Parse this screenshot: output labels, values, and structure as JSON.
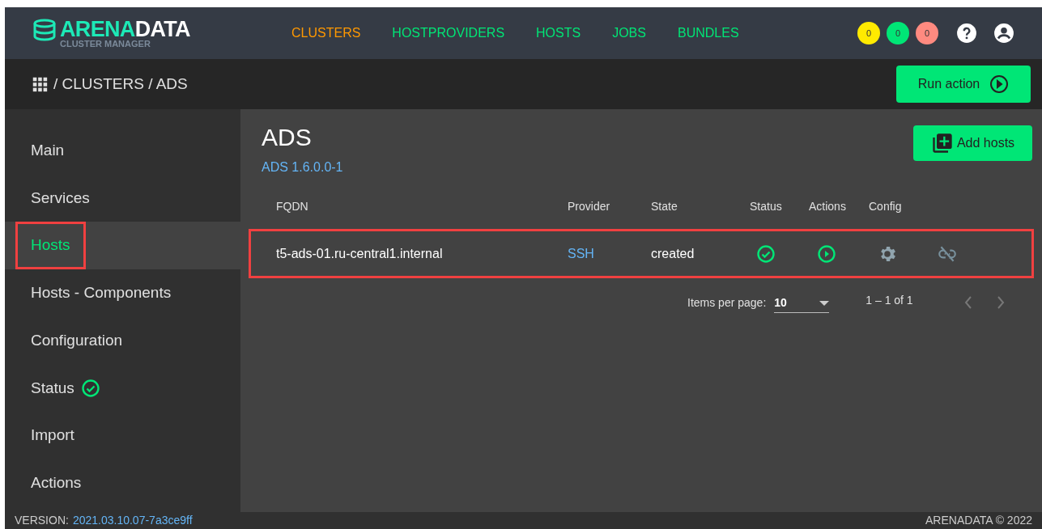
{
  "header": {
    "logo": {
      "title": "ARENA",
      "title_bold": "DATA",
      "subtitle": "CLUSTER MANAGER"
    },
    "nav": [
      {
        "label": "CLUSTERS",
        "selected": true
      },
      {
        "label": "HOSTPROVIDERS",
        "selected": false
      },
      {
        "label": "HOSTS",
        "selected": false
      },
      {
        "label": "JOBS",
        "selected": false
      },
      {
        "label": "BUNDLES",
        "selected": false
      }
    ],
    "badges": [
      {
        "count": "0",
        "color": "#ffea00"
      },
      {
        "count": "0",
        "color": "#00e676"
      },
      {
        "count": "0",
        "color": "#ff8a80"
      }
    ]
  },
  "breadcrumb": [
    "/ CLUSTERS / ADS"
  ],
  "run_action": "Run action",
  "sidebar": {
    "items": [
      {
        "label": "Main",
        "selected": false,
        "status": false
      },
      {
        "label": "Services",
        "selected": false,
        "status": false
      },
      {
        "label": "Hosts",
        "selected": true,
        "status": false
      },
      {
        "label": "Hosts - Components",
        "selected": false,
        "status": false
      },
      {
        "label": "Configuration",
        "selected": false,
        "status": false
      },
      {
        "label": "Status",
        "selected": false,
        "status": true
      },
      {
        "label": "Import",
        "selected": false,
        "status": false
      },
      {
        "label": "Actions",
        "selected": false,
        "status": false
      }
    ]
  },
  "page": {
    "title": "ADS",
    "subtitle": "ADS 1.6.0.0-1",
    "add_button": "Add hosts"
  },
  "table": {
    "columns": [
      "FQDN",
      "Provider",
      "State",
      "Status",
      "Actions",
      "Config"
    ],
    "rows": [
      {
        "fqdn": "t5-ads-01.ru-central1.internal",
        "provider": "SSH",
        "state": "created",
        "highlighted": true
      }
    ]
  },
  "paginator": {
    "label": "Items per page:",
    "page_size": "10",
    "range": "1 – 1 of 1"
  },
  "footer": {
    "version_label": "VERSION:",
    "version": "2021.03.10.07-7a3ce9ff",
    "copyright": "ARENADATA © 2022"
  }
}
